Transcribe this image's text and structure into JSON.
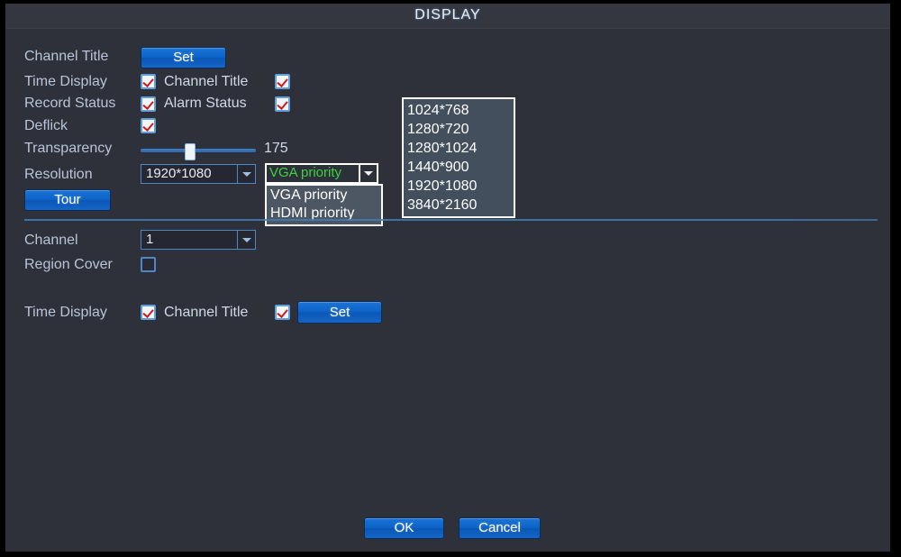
{
  "window": {
    "title": "DISPLAY"
  },
  "rows": {
    "channel_title_label": "Channel Title",
    "channel_title_set_button": "Set",
    "time_display_label": "Time Display",
    "channel_title_check_label": "Channel Title",
    "record_status_label": "Record Status",
    "alarm_status_label": "Alarm Status",
    "deflick_label": "Deflick",
    "transparency_label": "Transparency",
    "transparency_value": "175",
    "resolution_label": "Resolution",
    "tour_button": "Tour",
    "channel_label": "Channel",
    "region_cover_label": "Region Cover",
    "bottom_time_display_label": "Time Display",
    "bottom_channel_title_label": "Channel Title",
    "bottom_set_button": "Set"
  },
  "checkboxes": {
    "time_display": "checked",
    "channel_title": "checked",
    "record_status": "checked",
    "alarm_status": "checked",
    "deflick": "checked",
    "region_cover": "unchecked",
    "bottom_time_display": "checked",
    "bottom_channel_title": "checked"
  },
  "resolution_combo": {
    "value": "1920*1080"
  },
  "output_priority_combo": {
    "value": "VGA priority",
    "options": [
      "VGA priority",
      "HDMI priority"
    ]
  },
  "resolution_options_panel": {
    "options": [
      "1024*768",
      "1280*720",
      "1280*1024",
      "1440*900",
      "1920*1080",
      "3840*2160"
    ]
  },
  "channel_combo": {
    "value": "1"
  },
  "footer": {
    "ok_button": "OK",
    "cancel_button": "Cancel"
  },
  "colors": {
    "window_bg": "#2e313a",
    "title_bg": "#34373f",
    "accent_blue": "#0d63c8",
    "label_text": "#b9c4d8",
    "green_text": "#3fd13f",
    "check_red": "#d21b1b",
    "border_blue": "#4f86c6"
  }
}
